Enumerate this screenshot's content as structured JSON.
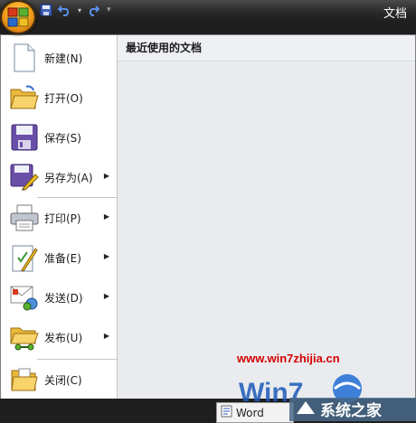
{
  "window": {
    "title": "文档"
  },
  "qat": {
    "icons": [
      "save-icon",
      "undo-icon",
      "redo-icon",
      "customize-icon"
    ]
  },
  "menu": {
    "items": [
      {
        "label": "新建(N)",
        "icon": "new-document-icon",
        "submenu": false
      },
      {
        "label": "打开(O)",
        "icon": "open-folder-icon",
        "submenu": false
      },
      {
        "label": "保存(S)",
        "icon": "save-icon",
        "submenu": false
      },
      {
        "label": "另存为(A)",
        "icon": "save-as-icon",
        "submenu": true
      },
      {
        "label": "打印(P)",
        "icon": "printer-icon",
        "submenu": true
      },
      {
        "label": "准备(E)",
        "icon": "prepare-icon",
        "submenu": true
      },
      {
        "label": "发送(D)",
        "icon": "send-icon",
        "submenu": true
      },
      {
        "label": "发布(U)",
        "icon": "publish-icon",
        "submenu": true
      },
      {
        "label": "关闭(C)",
        "icon": "close-folder-icon",
        "submenu": false
      }
    ]
  },
  "recent": {
    "header": "最近使用的文档"
  },
  "taskbar": {
    "word_label": "Word"
  },
  "watermark": {
    "url": "www.win7zhijia.cn",
    "brand": "系统之家"
  },
  "colors": {
    "accent": "#f4a21b",
    "watermark_red": "#d40000",
    "menu_bg": "#ffffff",
    "recent_bg": "#e9ebee"
  }
}
